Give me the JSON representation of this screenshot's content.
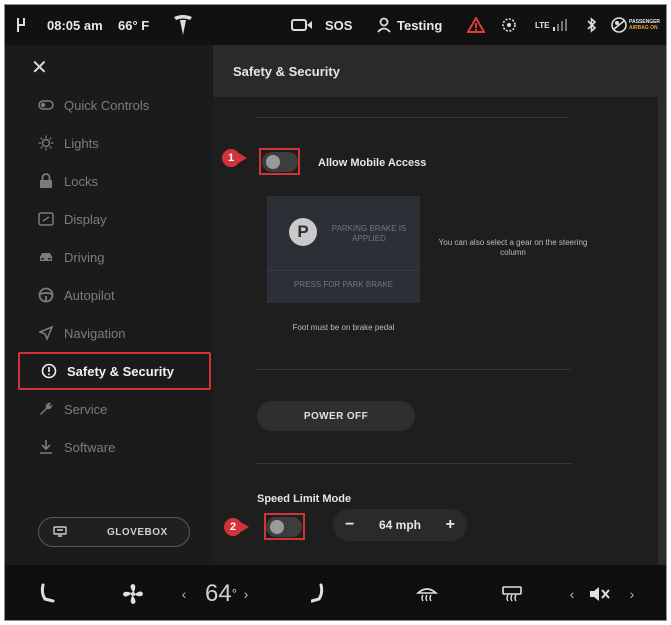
{
  "status_bar": {
    "time": "08:05 am",
    "temperature": "66° F",
    "sos": "SOS",
    "profile": "Testing",
    "lte": "LTE",
    "airbag_line1": "PASSENGER",
    "airbag_line2": "AIRBAG ON",
    "icons": [
      "door-icon",
      "tesla-logo-icon",
      "camera-icon",
      "person-icon",
      "warning-icon",
      "tire-pressure-icon",
      "signal-icon",
      "bluetooth-icon",
      "airbag-icon"
    ]
  },
  "sidebar": {
    "items": [
      {
        "label": "Quick Controls",
        "icon": "toggle-icon"
      },
      {
        "label": "Lights",
        "icon": "sun-icon"
      },
      {
        "label": "Locks",
        "icon": "lock-icon"
      },
      {
        "label": "Display",
        "icon": "display-icon"
      },
      {
        "label": "Driving",
        "icon": "car-icon"
      },
      {
        "label": "Autopilot",
        "icon": "steering-wheel-icon"
      },
      {
        "label": "Navigation",
        "icon": "navigation-arrow-icon"
      },
      {
        "label": "Safety & Security",
        "icon": "info-circle-icon",
        "active": true
      },
      {
        "label": "Service",
        "icon": "wrench-icon"
      },
      {
        "label": "Software",
        "icon": "download-icon"
      }
    ],
    "glovebox_label": "GLOVEBOX"
  },
  "panel": {
    "title": "Safety & Security",
    "mobile_access_label": "Allow Mobile Access",
    "mobile_access_on": false,
    "annotation_1": "1",
    "annotation_2": "2",
    "park_brake_status": "PARKING BRAKE IS APPLIED",
    "park_brake_button": "PRESS FOR PARK BRAKE",
    "park_p": "P",
    "gear_note": "You can also select a gear on the steering column",
    "brake_note": "Foot must be on brake pedal",
    "power_off_label": "POWER OFF",
    "speed_limit_label": "Speed Limit Mode",
    "speed_limit_on": false,
    "speed_value": "64 mph",
    "minus": "−",
    "plus": "+"
  },
  "bottom_bar": {
    "temperature": "64",
    "degree": "°",
    "chev_left": "‹",
    "chev_right": "›",
    "icons": [
      "seat-icon",
      "fan-icon",
      "seat-heater-icon",
      "defrost-front-icon",
      "defrost-rear-icon",
      "mute-volume-icon"
    ]
  },
  "colors": {
    "highlight": "#d13438",
    "background": "#1e1e1e",
    "sidebar": "#1b1b1b"
  }
}
